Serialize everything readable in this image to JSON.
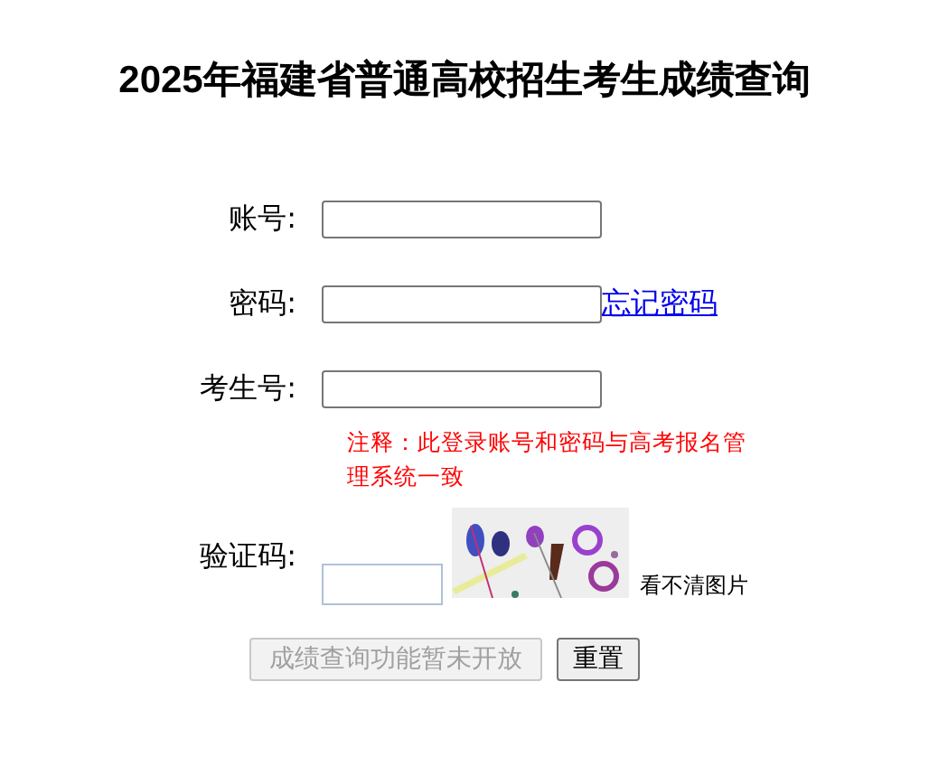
{
  "title": "2025年福建省普通高校招生考生成绩查询",
  "fields": [
    {
      "label": "账号:"
    },
    {
      "label": "密码:",
      "link": "忘记密码"
    },
    {
      "label": "考生号:"
    }
  ],
  "note": "注释：此登录账号和密码与高考报名管理系统一致",
  "captcha": {
    "label": "验证码:",
    "refresh": "看不清图片"
  },
  "buttons": [
    {
      "label": "成绩查询功能暂未开放",
      "disabled": true
    },
    {
      "label": "重置",
      "disabled": false
    }
  ]
}
